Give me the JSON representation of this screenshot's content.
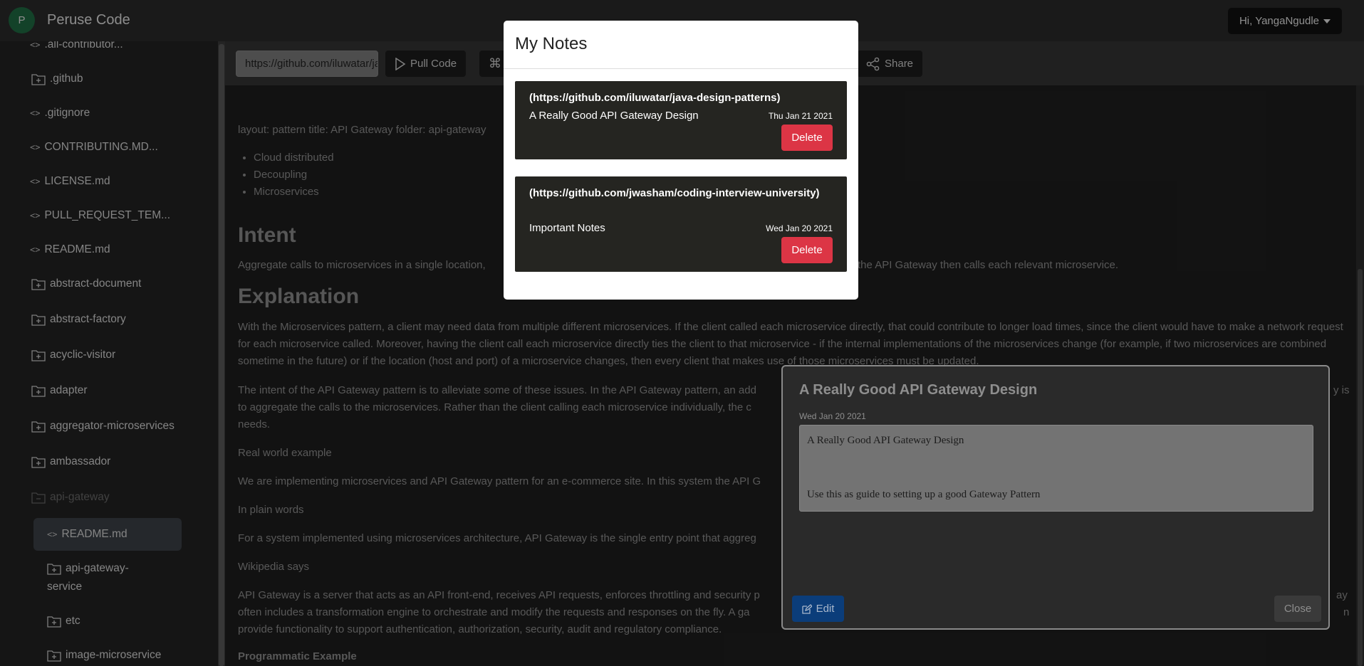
{
  "navbar": {
    "avatar_letter": "P",
    "brand": "Peruse Code",
    "user_menu": "Hi, YangaNgudle"
  },
  "sidebar": {
    "items": [
      {
        "type": "file",
        "label": ".all-contributor..."
      },
      {
        "type": "folder",
        "label": ".github"
      },
      {
        "type": "file",
        "label": ".gitignore"
      },
      {
        "type": "file",
        "label": "CONTRIBUTING.MD..."
      },
      {
        "type": "file",
        "label": "LICENSE.md"
      },
      {
        "type": "file",
        "label": "PULL_REQUEST_TEM..."
      },
      {
        "type": "file",
        "label": "README.md"
      },
      {
        "type": "folder",
        "label": "abstract-document"
      },
      {
        "type": "folder",
        "label": "abstract-factory"
      },
      {
        "type": "folder",
        "label": "acyclic-visitor"
      },
      {
        "type": "folder",
        "label": "adapter"
      },
      {
        "type": "folder",
        "label": "aggregator-microservices"
      },
      {
        "type": "folder",
        "label": "ambassador"
      },
      {
        "type": "folder-open",
        "label": "api-gateway"
      },
      {
        "type": "file",
        "label": "README.md"
      },
      {
        "type": "folder",
        "label": "api-gateway-",
        "label2": "service"
      },
      {
        "type": "folder",
        "label": "etc"
      },
      {
        "type": "folder",
        "label": "image-microservice"
      }
    ]
  },
  "toolbar": {
    "url_value": "https://github.com/iluwatar/java-design-patterns",
    "pull_code": "Pull Code",
    "share": "Share"
  },
  "content": {
    "front_matter": "layout: pattern title: API Gateway folder: api-gateway",
    "tags": [
      "Cloud distributed",
      "Decoupling",
      "Microservices"
    ],
    "intent_heading": "Intent",
    "intent_text_a": "Aggregate calls to microservices in a single location,",
    "intent_text_b": "the API Gateway then calls each relevant microservice.",
    "explanation_heading": "Explanation",
    "explanation_p1": "With the Microservices pattern, a client may need data from multiple different microservices. If the client called each microservice directly, that could contribute to longer load times, since the client would have to make a network request for each microservice called. Moreover, having the client call each microservice directly ties the client to that microservice - if the internal implementations of the microservices change (for example, if two microservices are combined sometime in the future) or if the location (host and port) of a microservice changes, then every client that makes use of those microservices must be updated.",
    "explanation_p2_a": "The intent of the API Gateway pattern is to alleviate some of these issues. In the API Gateway pattern, an add",
    "explanation_p2_a_right": "y is",
    "explanation_p2_b": "to aggregate the calls to the microservices. Rather than the client calling each microservice individually, the c",
    "explanation_p2_c": "needs.",
    "real_world_label": "Real world example",
    "real_world_text": "We are implementing microservices and API Gateway pattern for an e-commerce site. In this system the API G",
    "plain_words_label": "In plain words",
    "plain_words_text": "For a system implemented using microservices architecture, API Gateway is the single entry point that aggreg",
    "wikipedia_label": "Wikipedia says",
    "wikipedia_a": "API Gateway is a server that acts as an API front-end, receives API requests, enforces throttling and security p",
    "wikipedia_a_right": "ay",
    "wikipedia_b": "often includes a transformation engine to orchestrate and modify the requests and responses on the fly. A ga",
    "wikipedia_b_right": "n",
    "wikipedia_c": "provide functionality to support authentication, authorization, security, audit and regulatory compliance.",
    "programmatic_label": "Programmatic Example"
  },
  "notes_modal": {
    "title": "My Notes",
    "notes": [
      {
        "url": "(https://github.com/iluwatar/java-design-patterns)",
        "title": "A Really Good API Gateway Design",
        "date": "Thu Jan 21 2021",
        "delete": "Delete"
      },
      {
        "url": "(https://github.com/jwasham/coding-interview-university)",
        "title": "Important Notes",
        "date": "Wed Jan 20 2021",
        "delete": "Delete"
      }
    ]
  },
  "note_detail": {
    "title": "A Really Good API Gateway Design",
    "date": "Wed Jan 20 2021",
    "body_line1": "A Really Good API Gateway Design",
    "body_line2": "Use this as guide to setting up a good Gateway Pattern",
    "edit": "Edit",
    "close": "Close"
  }
}
